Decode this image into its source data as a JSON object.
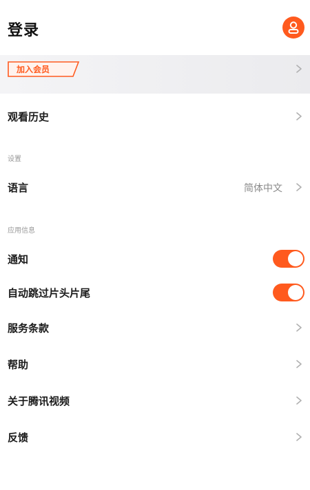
{
  "header": {
    "title": "登录",
    "avatar_icon": "user-icon",
    "accent_color": "#ff5a1e"
  },
  "vip": {
    "label": "加入会员"
  },
  "history": {
    "label": "观看历史"
  },
  "settings": {
    "section_label": "设置",
    "language_label": "语言",
    "language_value": "简体中文"
  },
  "app_info": {
    "section_label": "应用信息",
    "notification_label": "通知",
    "notification_on": true,
    "skip_label": "自动跳过片头片尾",
    "skip_on": true,
    "terms_label": "服务条款",
    "help_label": "帮助",
    "about_label": "关于腾讯视频",
    "feedback_label": "反馈"
  }
}
